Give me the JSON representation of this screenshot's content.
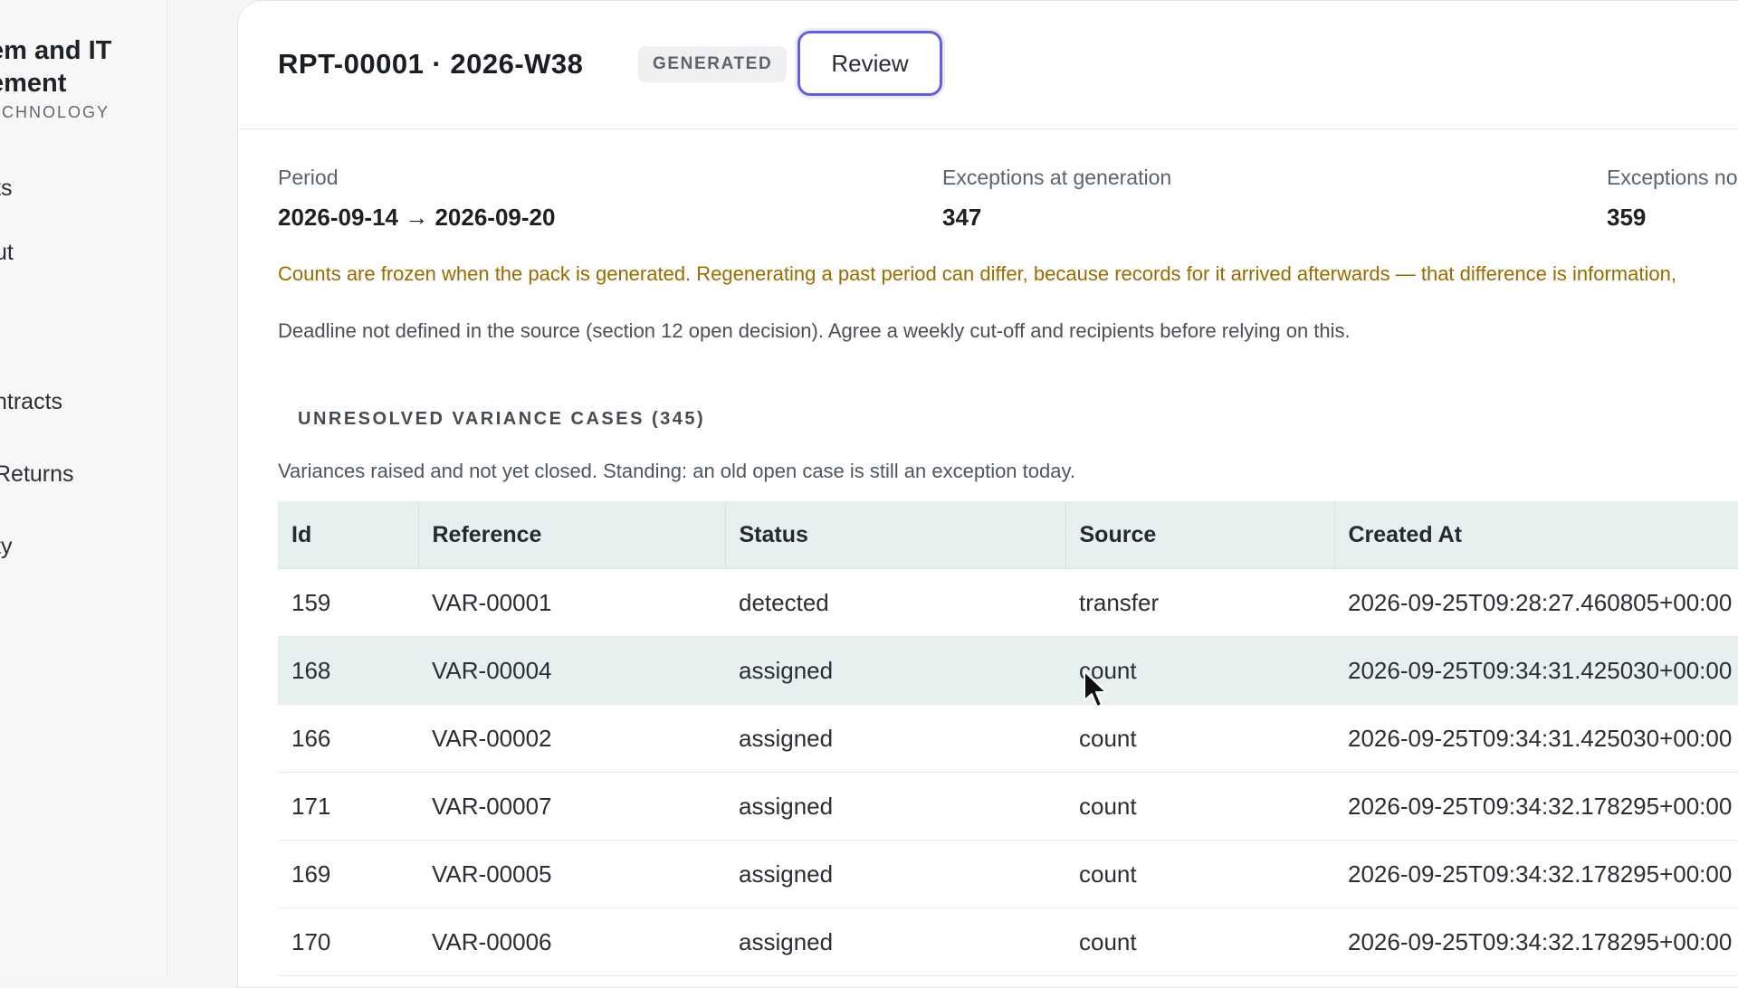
{
  "sidebar": {
    "brand_line1": "em and IT",
    "brand_line2": "ement",
    "brand_sub": "ECHNOLOGY",
    "items": [
      {
        "label": "ts"
      },
      {
        "label": "ut"
      },
      {
        "label": "ntracts"
      },
      {
        "label": "Returns"
      },
      {
        "label": "ty"
      }
    ]
  },
  "report": {
    "title": "RPT-00001 · 2026-W38",
    "status": "GENERATED",
    "review_label": "Review"
  },
  "metrics": [
    {
      "label": "Period",
      "value": "2026-09-14 → 2026-09-20"
    },
    {
      "label": "Exceptions at generation",
      "value": "347"
    },
    {
      "label": "Exceptions no",
      "value": "359"
    }
  ],
  "notes": {
    "warning": "Counts are frozen when the pack is generated. Regenerating a past period can differ, because records for it arrived afterwards — that difference is information,",
    "deadline": "Deadline not defined in the source (section 12 open decision). Agree a weekly cut-off and recipients before relying on this."
  },
  "section": {
    "title": "UNRESOLVED VARIANCE CASES (345)",
    "description": "Variances raised and not yet closed. Standing: an old open case is still an exception today."
  },
  "table": {
    "columns": [
      "Id",
      "Reference",
      "Status",
      "Source",
      "Created At"
    ],
    "rows": [
      [
        "159",
        "VAR-00001",
        "detected",
        "transfer",
        "2026-09-25T09:28:27.460805+00:00"
      ],
      [
        "168",
        "VAR-00004",
        "assigned",
        "count",
        "2026-09-25T09:34:31.425030+00:00"
      ],
      [
        "166",
        "VAR-00002",
        "assigned",
        "count",
        "2026-09-25T09:34:31.425030+00:00"
      ],
      [
        "171",
        "VAR-00007",
        "assigned",
        "count",
        "2026-09-25T09:34:32.178295+00:00"
      ],
      [
        "169",
        "VAR-00005",
        "assigned",
        "count",
        "2026-09-25T09:34:32.178295+00:00"
      ],
      [
        "170",
        "VAR-00006",
        "assigned",
        "count",
        "2026-09-25T09:34:32.178295+00:00"
      ]
    ]
  },
  "colors": {
    "accent": "#6360e0",
    "warning_text": "#9a6b00",
    "table_header_bg": "#e6f1ef"
  }
}
